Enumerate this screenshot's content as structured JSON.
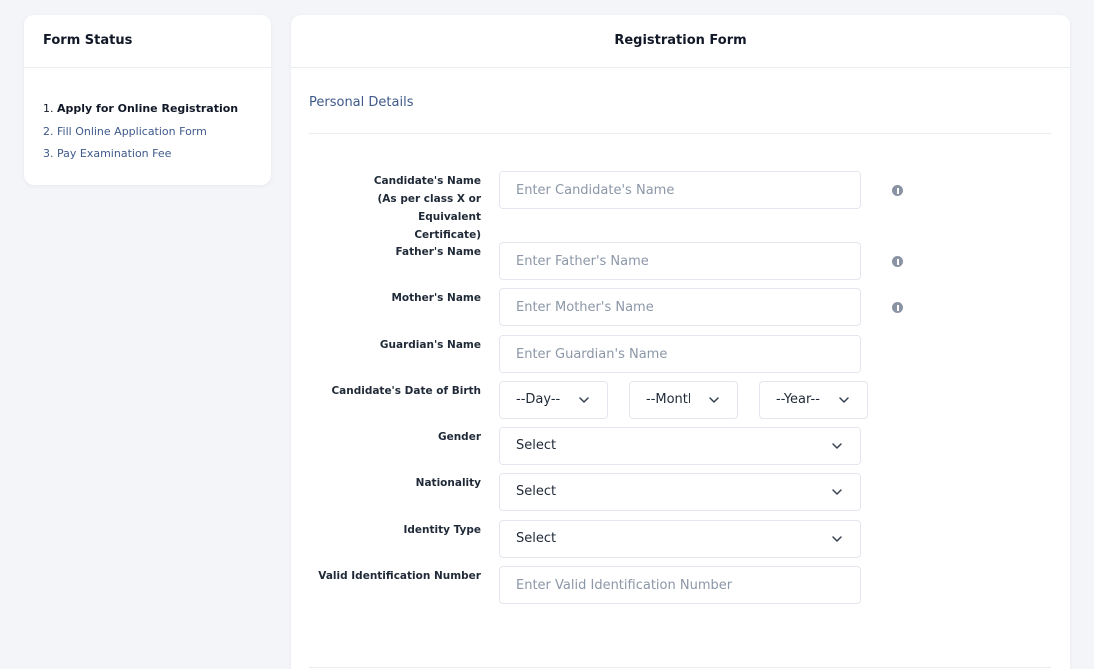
{
  "status": {
    "title": "Form Status",
    "steps": [
      {
        "num": "1.",
        "label": "Apply for Online Registration",
        "active": true
      },
      {
        "num": "2.",
        "label": "Fill Online Application Form",
        "active": false
      },
      {
        "num": "3.",
        "label": "Pay Examination Fee",
        "active": false
      }
    ]
  },
  "form": {
    "title": "Registration Form",
    "section": "Personal Details",
    "fields": {
      "candidate_name": {
        "label_line1": "Candidate's Name",
        "label_line2": "(As per class X or Equivalent",
        "label_line3": "Certificate)",
        "placeholder": "Enter Candidate's Name",
        "info_icon": "info-icon"
      },
      "father_name": {
        "label": "Father's Name",
        "placeholder": "Enter Father's Name",
        "info_icon": "info-icon"
      },
      "mother_name": {
        "label": "Mother's Name",
        "placeholder": "Enter Mother's Name",
        "info_icon": "info-icon"
      },
      "guardian_name": {
        "label": "Guardian's Name",
        "placeholder": "Enter Guardian's Name"
      },
      "dob": {
        "label": "Candidate's Date of Birth",
        "day": "--Day--",
        "month": "--Month--",
        "year": "--Year--"
      },
      "gender": {
        "label": "Gender",
        "value": "Select"
      },
      "nationality": {
        "label": "Nationality",
        "value": "Select"
      },
      "identity_type": {
        "label": "Identity Type",
        "value": "Select"
      },
      "id_number": {
        "label": "Valid Identification Number",
        "placeholder": "Enter Valid Identification Number"
      }
    }
  },
  "colors": {
    "background": "#f3f5f9",
    "card": "#ffffff",
    "muted_blue": "#3f5a8a",
    "placeholder": "#8c97a8",
    "border": "#e3e7ed"
  }
}
